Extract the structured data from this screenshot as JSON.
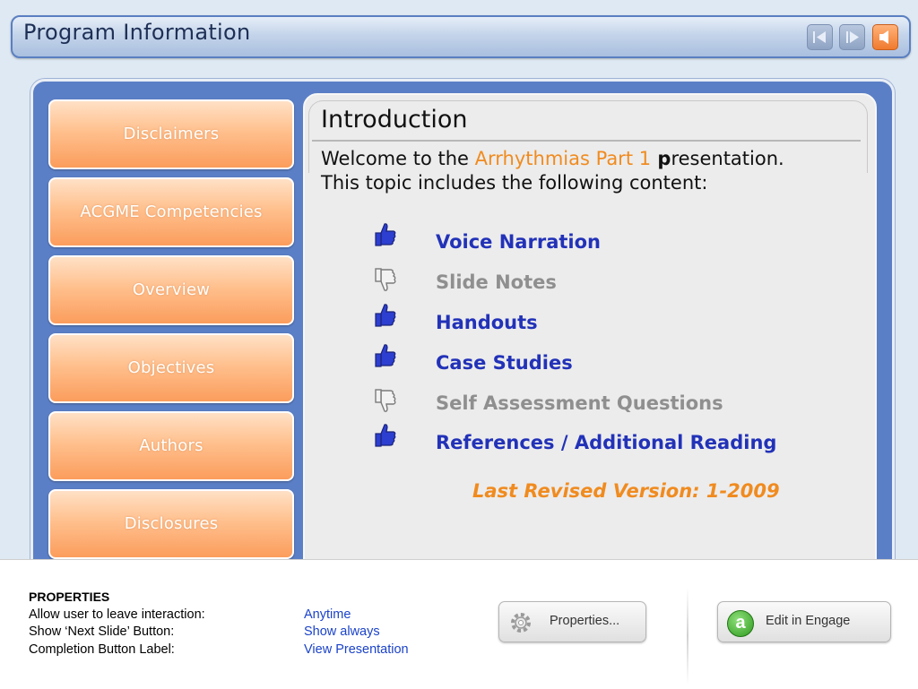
{
  "header": {
    "title": "Program Information",
    "icons": [
      "prev-slide-icon",
      "next-slide-icon",
      "audio-icon"
    ],
    "accent": "#f07b2e"
  },
  "sidebar": {
    "items": [
      {
        "label": "Disclaimers"
      },
      {
        "label": "ACGME Competencies"
      },
      {
        "label": "Overview"
      },
      {
        "label": "Objectives"
      },
      {
        "label": "Authors"
      },
      {
        "label": "Disclosures"
      }
    ]
  },
  "content": {
    "title": "Introduction",
    "welcome_pre": "Welcome to the ",
    "welcome_highlight": "Arrhythmias Part 1",
    "welcome_post_bold": " p",
    "welcome_post": "resentation.",
    "welcome_line2": "This topic includes the following content:",
    "items": [
      {
        "label": "Voice Narration",
        "icon": "thumbs-up-icon"
      },
      {
        "label": "Slide Notes",
        "icon": "thumbs-down-icon"
      },
      {
        "label": "Handouts",
        "icon": "thumbs-up-icon"
      },
      {
        "label": "Case Studies",
        "icon": "thumbs-up-icon"
      },
      {
        "label": "Self Assessment Questions",
        "icon": "thumbs-down-icon"
      },
      {
        "label": "References / Additional Reading",
        "icon": "thumbs-up-icon"
      }
    ],
    "revised": "Last Revised Version: 1-2009",
    "colors": {
      "included": "#2232b8",
      "excluded": "#8f8f8f",
      "highlight": "#f08b1f"
    }
  },
  "properties": {
    "title": "PROPERTIES",
    "rows": [
      {
        "label": "Allow user to leave interaction:",
        "value": "Anytime"
      },
      {
        "label": "Show ‘Next Slide’ Button:",
        "value": "Show always"
      },
      {
        "label": "Completion Button Label:",
        "value": "View Presentation"
      }
    ],
    "properties_button": "Properties...",
    "engage_button": "Edit in Engage",
    "engage_icon_letter": "a"
  }
}
